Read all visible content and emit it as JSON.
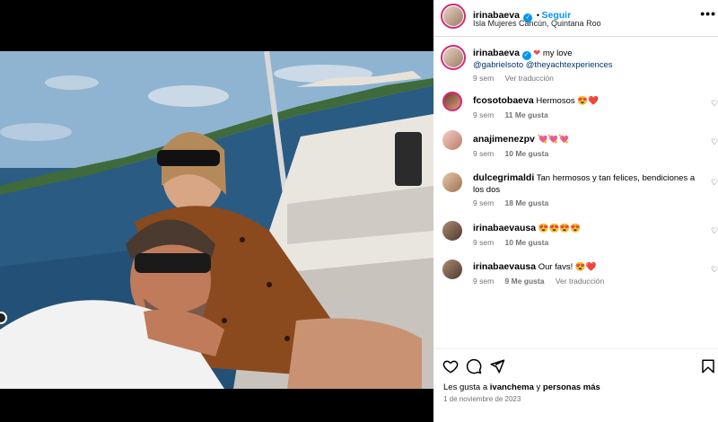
{
  "post": {
    "username": "irinabaeva",
    "follow_label": "Seguir",
    "location": "Isla Mujeres Cancún, Quintana Roo",
    "caption": {
      "username": "irinabaeva",
      "text": "my love",
      "mention1": "@gabrielsoto",
      "mention2": "@theyachtexperiences",
      "time": "9 sem",
      "translate": "Ver traducción"
    }
  },
  "comments": [
    {
      "username": "fcosotobaeva",
      "text": "Hermosos 😍❤️",
      "time": "9 sem",
      "likes": "11 Me gusta"
    },
    {
      "username": "anajimenezpv",
      "text": "💘💘💘",
      "time": "9 sem",
      "likes": "10 Me gusta"
    },
    {
      "username": "dulcegrimaldi",
      "text": "Tan hermosos y tan felices, bendiciones a los dos",
      "time": "9 sem",
      "likes": "18 Me gusta"
    },
    {
      "username": "irinabaevausa",
      "text": "😍😍😍😍",
      "time": "9 sem",
      "likes": "10 Me gusta"
    },
    {
      "username": "irinabaevausa",
      "text": "Our favs! 😍❤️",
      "time": "9 sem",
      "likes": "9 Me gusta",
      "translate": "Ver traducción"
    }
  ],
  "footer": {
    "likes_prefix": "Les gusta a",
    "likes_user": "ivanchema",
    "likes_mid": "y",
    "likes_others": "personas más",
    "date": "1 de noviembre de 2023"
  },
  "colors": {
    "accent": "#0095f6",
    "muted": "#737373",
    "heart": "#ed4956"
  }
}
